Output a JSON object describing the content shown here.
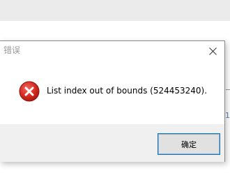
{
  "dialog": {
    "title": "错误",
    "message": "List index out of bounds (524453240).",
    "ok_label": "确定",
    "icon": "error-icon",
    "close_icon": "close-icon"
  },
  "background": {
    "partial_char": "1"
  },
  "colors": {
    "title_text": "#9a9a9a",
    "footer_bg": "#f0f0f0",
    "button_bg": "#e1e1e1",
    "button_focus": "#0078d7",
    "error_red": "#d0201e"
  }
}
